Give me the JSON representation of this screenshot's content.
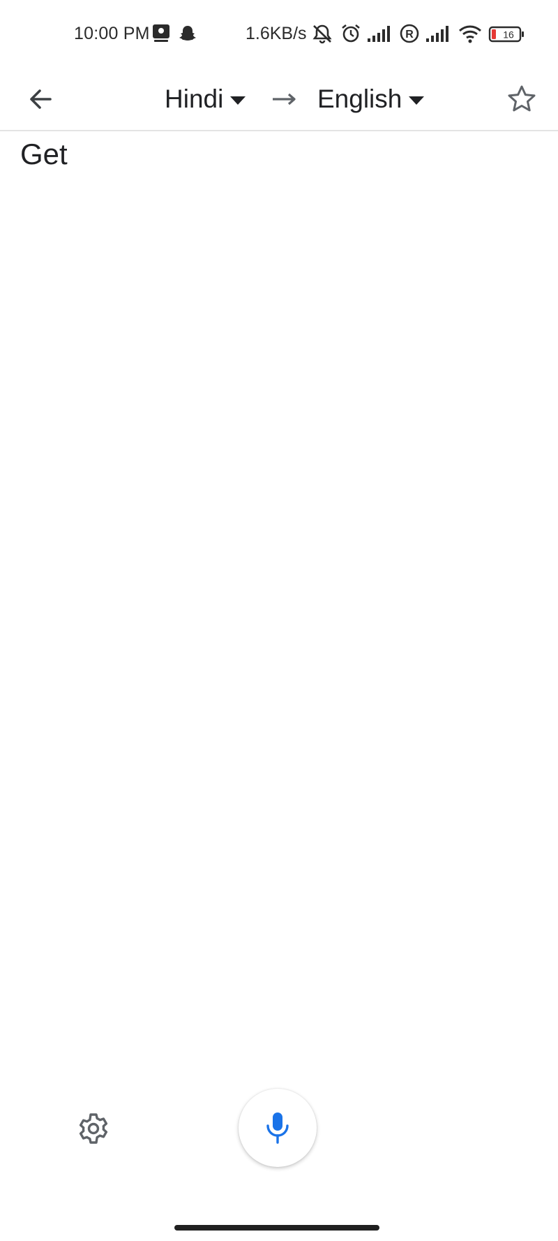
{
  "status_bar": {
    "time": "10:00 PM",
    "network_speed": "1.6KB/s",
    "battery_level": "16",
    "icons": [
      "gallery-notification-icon",
      "snapchat-icon",
      "muted-bell-icon",
      "alarm-icon",
      "signal-sim1-icon",
      "roaming-icon",
      "signal-sim2-icon",
      "wifi-icon",
      "battery-icon"
    ],
    "battery_color": "#e53935"
  },
  "app_bar": {
    "source_language": "Hindi",
    "target_language": "English",
    "back_icon": "arrow-back-icon",
    "swap_icon": "arrow-right-icon",
    "favorite_icon": "star-outline-icon"
  },
  "transcript": {
    "text": "Get"
  },
  "controls": {
    "settings_icon": "gear-icon",
    "mic_icon": "microphone-icon",
    "mic_color": "#1a73e8"
  },
  "colors": {
    "text_primary": "#202124",
    "icon_gray": "#5f6368",
    "accent_blue": "#1a73e8",
    "divider": "#e3e3e3"
  }
}
